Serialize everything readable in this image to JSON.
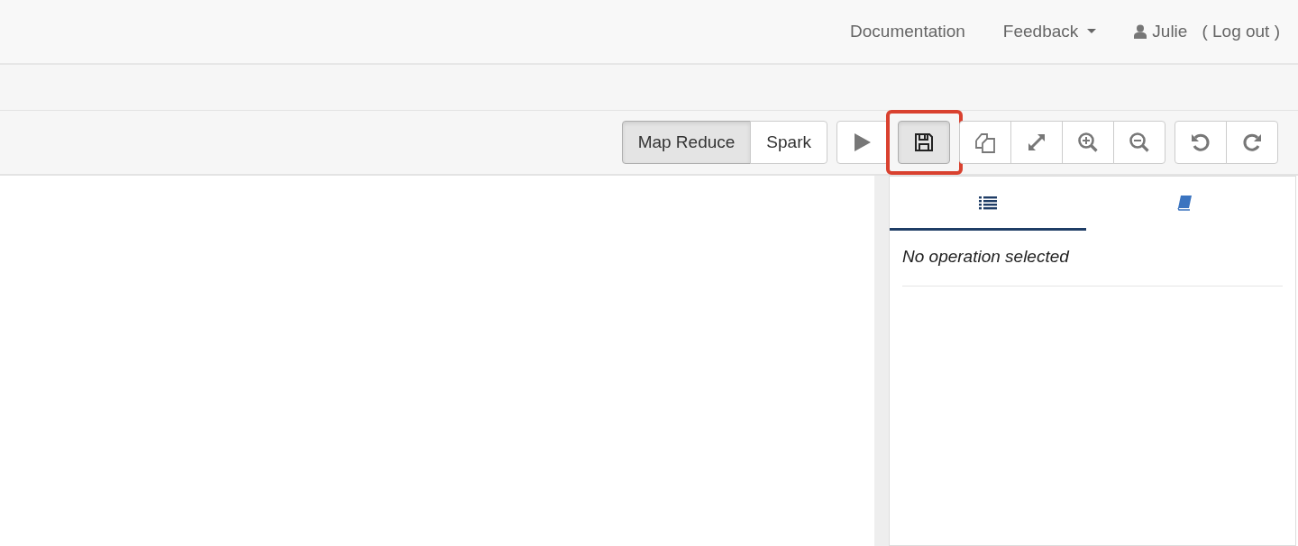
{
  "navbar": {
    "links": [
      {
        "kind": "link",
        "label": "Documentation"
      },
      {
        "kind": "dropdown",
        "label": "Feedback"
      },
      {
        "kind": "user",
        "label": "Julie"
      }
    ],
    "logout": "( Log out )"
  },
  "toolbar": {
    "engines": [
      {
        "label": "Map Reduce",
        "selected": true
      },
      {
        "label": "Spark",
        "selected": false
      }
    ],
    "groups": [
      {
        "buttons": [
          {
            "kind": "run",
            "pressed": false,
            "highlighted": false
          }
        ]
      },
      {
        "buttons": [
          {
            "kind": "save",
            "pressed": true,
            "highlighted": true
          }
        ]
      },
      {
        "buttons": [
          {
            "kind": "copy",
            "pressed": false,
            "highlighted": false
          },
          {
            "kind": "expand",
            "pressed": false,
            "highlighted": false
          },
          {
            "kind": "zoom-in",
            "pressed": false,
            "highlighted": false
          },
          {
            "kind": "zoom-out",
            "pressed": false,
            "highlighted": false
          }
        ]
      },
      {
        "buttons": [
          {
            "kind": "undo",
            "pressed": false,
            "highlighted": false
          },
          {
            "kind": "redo",
            "pressed": false,
            "highlighted": false
          }
        ]
      }
    ]
  },
  "panel": {
    "tabs": [
      {
        "kind": "list",
        "selected": true
      },
      {
        "kind": "book",
        "selected": false
      }
    ],
    "message": "No operation selected"
  }
}
